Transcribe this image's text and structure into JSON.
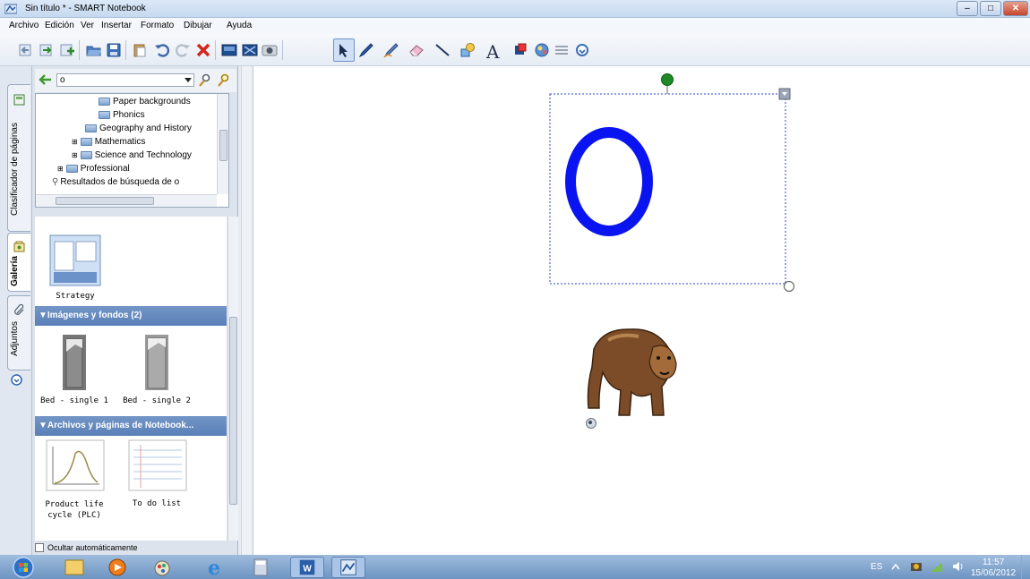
{
  "window": {
    "title": "Sin título * - SMART Notebook",
    "app_icon": "smart-notebook-icon",
    "controls": [
      "minimize-icon",
      "maximize-icon",
      "close-icon"
    ],
    "minimize_label": "–",
    "maximize_label": "□",
    "close_label": "✕"
  },
  "menubar": {
    "items": [
      "Archivo",
      "Edición",
      "Ver",
      "Insertar",
      "Formato",
      "Dibujar",
      "Ayuda"
    ]
  },
  "toolbar": {
    "buttons": [
      "previous-page-icon",
      "next-page-icon",
      "add-page-icon",
      "open-file-icon",
      "save-icon",
      "paste-icon",
      "undo-icon",
      "redo-icon",
      "delete-icon",
      "screen-shade-icon",
      "full-screen-icon",
      "capture-icon",
      "select-icon",
      "pen-icon",
      "creative-pen-icon",
      "eraser-icon",
      "line-icon",
      "shape-icon",
      "text-icon",
      "fill-icon",
      "properties-icon",
      "move-toolbar-icon",
      "more-icon"
    ],
    "text_tool_label": "A"
  },
  "side_tabs": [
    {
      "label": "Clasificador de páginas",
      "icon": "page-sorter-icon"
    },
    {
      "label": "Galería",
      "icon": "gallery-icon",
      "active": true
    },
    {
      "label": "Adjuntos",
      "icon": "paperclip-icon"
    }
  ],
  "gallery": {
    "search_value": "o",
    "tree": [
      {
        "label": "Paper backgrounds",
        "level": 3
      },
      {
        "label": "Phonics",
        "level": 3
      },
      {
        "label": "Geography and History",
        "level": 2
      },
      {
        "label": "Mathematics",
        "level": 2,
        "expandable": true
      },
      {
        "label": "Science and Technology",
        "level": 2,
        "expandable": true
      },
      {
        "label": "Professional",
        "level": 1,
        "expandable": true
      },
      {
        "label": "Resultados de búsqueda de o",
        "level": 1,
        "search": true
      }
    ],
    "top_items": [
      {
        "label": "Strategy"
      }
    ],
    "sections": [
      {
        "title": "▼Imágenes y fondos (2)",
        "items": [
          {
            "label": "Bed - single 1"
          },
          {
            "label": "Bed - single 2"
          }
        ]
      },
      {
        "title": "▼Archivos y páginas de Notebook...",
        "items": [
          {
            "label": "Product life cycle (PLC)"
          },
          {
            "label": "To do list"
          }
        ]
      }
    ],
    "auto_hide_label": "Ocultar automáticamente"
  },
  "canvas": {
    "text_object": "O",
    "text_color": "#0a14f0",
    "image_object": "brown-bear-image"
  },
  "taskbar": {
    "apps": [
      "start-orb-icon",
      "explorer-icon",
      "media-player-icon",
      "paint-icon",
      "internet-explorer-icon",
      "calculator-icon",
      "word-icon",
      "smart-notebook-icon"
    ],
    "language": "ES",
    "time": "11:57",
    "date": "15/06/2012"
  }
}
